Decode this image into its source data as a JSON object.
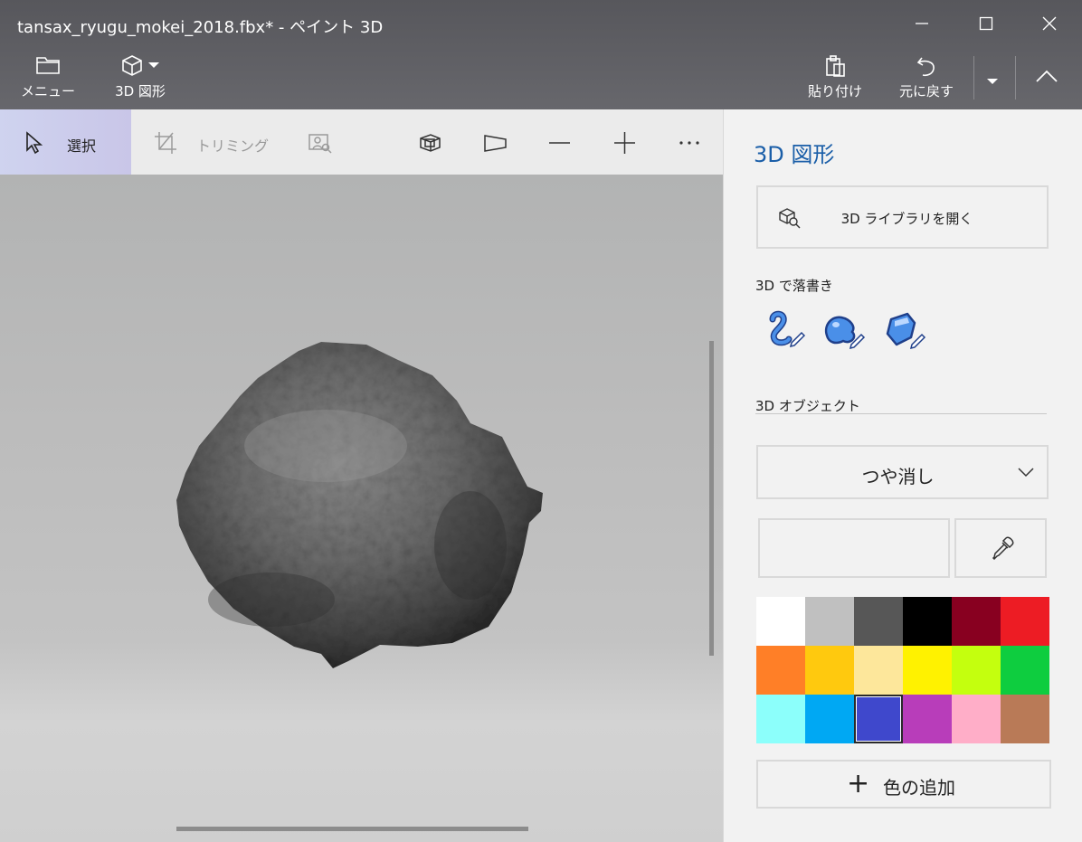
{
  "window": {
    "title": "tansax_ryugu_mokei_2018.fbx* - ペイント 3D"
  },
  "top_commands": {
    "menu_label": "メニュー",
    "shapes_label": "3D 図形",
    "paste_label": "貼り付け",
    "undo_label": "元に戻す"
  },
  "canvas_toolbar": {
    "select_label": "選択",
    "crop_label": "トリミング"
  },
  "panel": {
    "title": "3D 図形",
    "library_button": "3D ライブラリを開く",
    "doodle_heading": "3D で落書き",
    "object_heading": "3D オブジェクト",
    "finish_value": "つや消し",
    "add_color_label": "色の追加"
  },
  "palette": [
    "#ffffff",
    "#c0c0c0",
    "#575757",
    "#000000",
    "#880020",
    "#ed1c24",
    "#ff7f27",
    "#ffc90e",
    "#fde79b",
    "#fff200",
    "#c4ff0e",
    "#0ecd3f",
    "#8cfffb",
    "#00a8f3",
    "#3f48cc",
    "#b83dba",
    "#ffaec8",
    "#b97a57"
  ],
  "selected_color": "#3f48cc",
  "accent_color": "#1a5ea8"
}
